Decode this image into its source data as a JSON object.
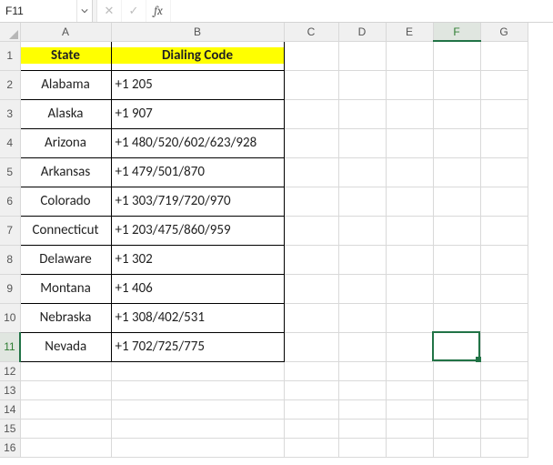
{
  "cell_ref": "F11",
  "fx_label": "fx",
  "formula_value": "",
  "columns": [
    "A",
    "B",
    "C",
    "D",
    "E",
    "F",
    "G"
  ],
  "row_numbers": [
    1,
    2,
    3,
    4,
    5,
    6,
    7,
    8,
    9,
    10,
    11,
    12,
    13,
    14,
    15,
    16
  ],
  "headers": {
    "state": "State",
    "dialing": "Dialing Code"
  },
  "rows": [
    {
      "state": "Alabama",
      "dialing": "+1 205"
    },
    {
      "state": "Alaska",
      "dialing": "+1 907"
    },
    {
      "state": "Arizona",
      "dialing": "+1 480/520/602/623/928"
    },
    {
      "state": "Arkansas",
      "dialing": "+1 479/501/870"
    },
    {
      "state": "Colorado",
      "dialing": "+1 303/719/720/970"
    },
    {
      "state": "Connecticut",
      "dialing": "+1 203/475/860/959"
    },
    {
      "state": "Delaware",
      "dialing": "+1 302"
    },
    {
      "state": "Montana",
      "dialing": "+1 406"
    },
    {
      "state": "Nebraska",
      "dialing": "+1 308/402/531"
    },
    {
      "state": "Nevada",
      "dialing": "+1 702/725/775"
    }
  ],
  "icons": {
    "cancel": "✕",
    "enter": "✓"
  },
  "chart_data": {
    "type": "table",
    "title": "",
    "columns": [
      "State",
      "Dialing Code"
    ],
    "rows": [
      [
        "Alabama",
        "+1 205"
      ],
      [
        "Alaska",
        "+1 907"
      ],
      [
        "Arizona",
        "+1 480/520/602/623/928"
      ],
      [
        "Arkansas",
        "+1 479/501/870"
      ],
      [
        "Colorado",
        "+1 303/719/720/970"
      ],
      [
        "Connecticut",
        "+1 203/475/860/959"
      ],
      [
        "Delaware",
        "+1 302"
      ],
      [
        "Montana",
        "+1 406"
      ],
      [
        "Nebraska",
        "+1 308/402/531"
      ],
      [
        "Nevada",
        "+1 702/725/775"
      ]
    ]
  }
}
